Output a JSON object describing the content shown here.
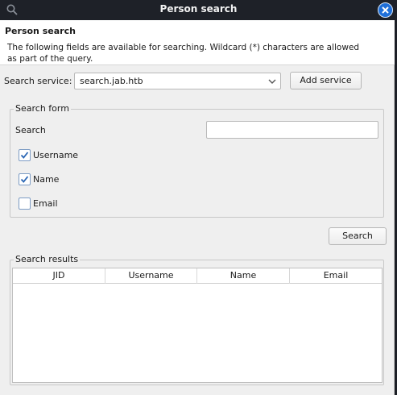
{
  "window": {
    "title": "Person search"
  },
  "header": {
    "title": "Person search",
    "description": "The following fields are available for searching. Wildcard (*) characters are allowed as part of the query."
  },
  "service": {
    "label": "Search service:",
    "selected": "search.jab.htb",
    "add_button": "Add service"
  },
  "form": {
    "legend": "Search form",
    "search_label": "Search",
    "search_value": "",
    "checkboxes": [
      {
        "label": "Username",
        "checked": true
      },
      {
        "label": "Name",
        "checked": true
      },
      {
        "label": "Email",
        "checked": false
      }
    ]
  },
  "actions": {
    "search_button": "Search"
  },
  "results": {
    "legend": "Search results",
    "columns": [
      "JID",
      "Username",
      "Name",
      "Email"
    ],
    "rows": []
  },
  "colors": {
    "accent": "#1f6fd8",
    "check": "#2a66b5",
    "titlebar": "#1e2128"
  }
}
